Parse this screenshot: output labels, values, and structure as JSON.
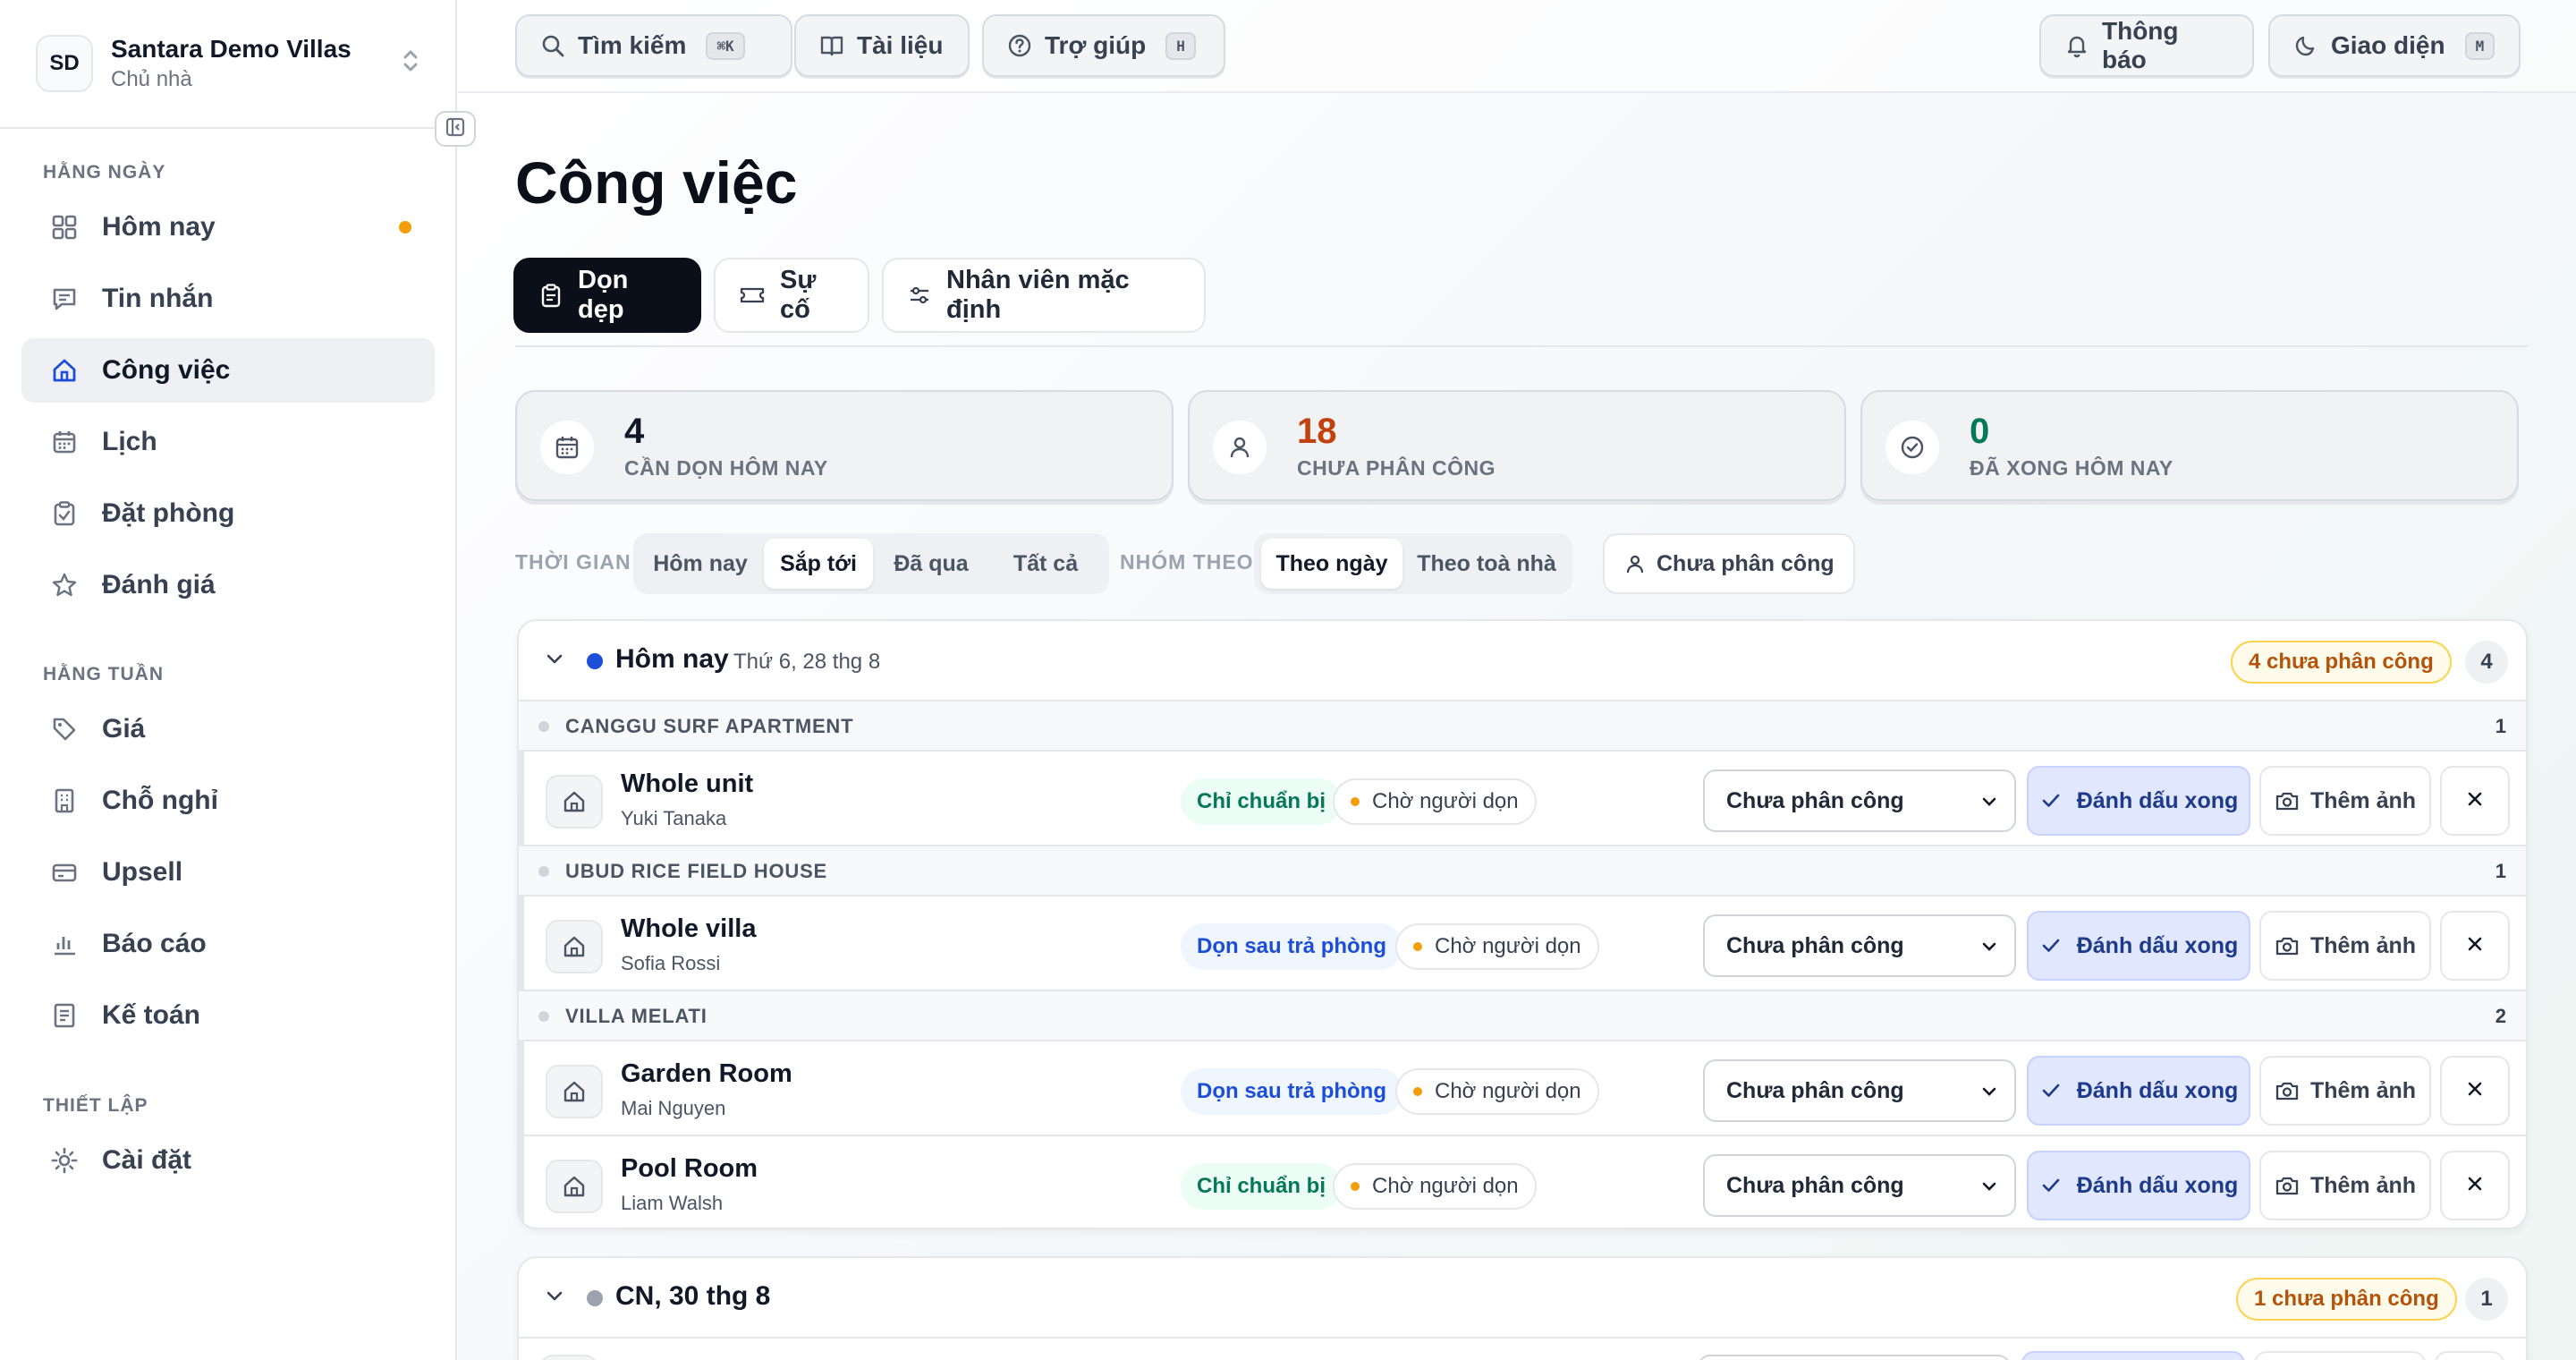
{
  "workspace": {
    "initials": "SD",
    "name": "Santara Demo Villas",
    "role": "Chủ nhà"
  },
  "sidebar": {
    "sections": [
      {
        "label": "HẰNG NGÀY"
      },
      {
        "label": "HẰNG TUẦN"
      },
      {
        "label": "THIẾT LẬP"
      }
    ],
    "items": [
      {
        "label": "Hôm nay",
        "icon": "grid-icon",
        "has_dot": true
      },
      {
        "label": "Tin nhắn",
        "icon": "message-icon"
      },
      {
        "label": "Công việc",
        "icon": "home-icon",
        "active": true
      },
      {
        "label": "Lịch",
        "icon": "calendar-icon"
      },
      {
        "label": "Đặt phòng",
        "icon": "clipboard-check-icon"
      },
      {
        "label": "Đánh giá",
        "icon": "star-icon"
      },
      {
        "label": "Giá",
        "icon": "tag-icon"
      },
      {
        "label": "Chỗ nghỉ",
        "icon": "building-icon"
      },
      {
        "label": "Upsell",
        "icon": "card-icon"
      },
      {
        "label": "Báo cáo",
        "icon": "bar-chart-icon"
      },
      {
        "label": "Kế toán",
        "icon": "ledger-icon"
      },
      {
        "label": "Cài đặt",
        "icon": "sun-icon"
      }
    ]
  },
  "topbar": {
    "search": {
      "label": "Tìm kiếm",
      "shortcut": "⌘K"
    },
    "docs": {
      "label": "Tài liệu"
    },
    "help": {
      "label": "Trợ giúp",
      "shortcut": "H"
    },
    "notifications": {
      "label": "Thông báo"
    },
    "theme": {
      "label": "Giao diện",
      "shortcut": "M"
    }
  },
  "page": {
    "title": "Công việc"
  },
  "tabs": [
    {
      "label": "Dọn dẹp",
      "active": true
    },
    {
      "label": "Sự cố"
    },
    {
      "label": "Nhân viên mặc định"
    }
  ],
  "stats": [
    {
      "value": "4",
      "label": "CẦN DỌN HÔM NAY",
      "color": "#111827"
    },
    {
      "value": "18",
      "label": "CHƯA PHÂN CÔNG",
      "color": "#c2410c"
    },
    {
      "value": "0",
      "label": "ĐÃ XONG HÔM NAY",
      "color": "#047857"
    }
  ],
  "filters": {
    "time_label": "THỜI GIAN",
    "time_options": [
      "Hôm nay",
      "Sắp tới",
      "Đã qua",
      "Tất cả"
    ],
    "time_selected": "Sắp tới",
    "group_label": "NHÓM THEO",
    "group_options": [
      "Theo ngày",
      "Theo toà nhà"
    ],
    "group_selected": "Theo ngày",
    "assign_filter": "Chưa phân công"
  },
  "groups": [
    {
      "title": "Hôm nay",
      "date": "Thứ 6, 28 thg 8",
      "dot_color": "#1d4ed8",
      "unassigned": "4 chưa phân công",
      "count": "4",
      "properties": [
        {
          "name": "CANGGU SURF APARTMENT",
          "count": "1",
          "tasks": [
            {
              "unit": "Whole unit",
              "guest": "Yuki Tanaka",
              "type": "Chỉ chuẩn bị",
              "type_style": "green",
              "status": "Chờ người dọn",
              "assignee": "Chưa phân công",
              "done_label": "Đánh dấu xong",
              "photo_label": "Thêm ảnh"
            }
          ]
        },
        {
          "name": "UBUD RICE FIELD HOUSE",
          "count": "1",
          "tasks": [
            {
              "unit": "Whole villa",
              "guest": "Sofia Rossi",
              "type": "Dọn sau trả phòng",
              "type_style": "blue",
              "status": "Chờ người dọn",
              "assignee": "Chưa phân công",
              "done_label": "Đánh dấu xong",
              "photo_label": "Thêm ảnh"
            }
          ]
        },
        {
          "name": "VILLA MELATI",
          "count": "2",
          "tasks": [
            {
              "unit": "Garden Room",
              "guest": "Mai Nguyen",
              "type": "Dọn sau trả phòng",
              "type_style": "blue",
              "status": "Chờ người dọn",
              "assignee": "Chưa phân công",
              "done_label": "Đánh dấu xong",
              "photo_label": "Thêm ảnh"
            },
            {
              "unit": "Pool Room",
              "guest": "Liam Walsh",
              "type": "Chỉ chuẩn bị",
              "type_style": "green",
              "status": "Chờ người dọn",
              "assignee": "Chưa phân công",
              "done_label": "Đánh dấu xong",
              "photo_label": "Thêm ảnh"
            }
          ]
        }
      ]
    },
    {
      "title": "CN, 30 thg 8",
      "date": "",
      "dot_color": "#9ca3af",
      "unassigned": "1 chưa phân công",
      "count": "1",
      "properties": []
    }
  ]
}
